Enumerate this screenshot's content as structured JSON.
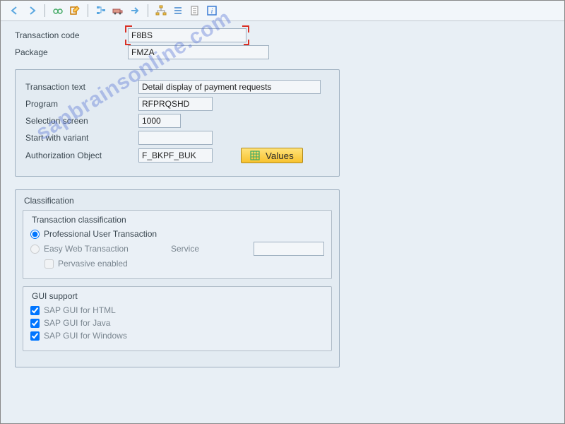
{
  "header": {
    "transaction_code_label": "Transaction code",
    "transaction_code_value": "F8BS",
    "package_label": "Package",
    "package_value": "FMZA"
  },
  "details": {
    "transaction_text_label": "Transaction text",
    "transaction_text_value": "Detail display of payment requests",
    "program_label": "Program",
    "program_value": "RFPRQSHD",
    "selection_screen_label": "Selection screen",
    "selection_screen_value": "1000",
    "start_variant_label": "Start with variant",
    "start_variant_value": "",
    "auth_object_label": "Authorization Object",
    "auth_object_value": "F_BKPF_BUK",
    "values_button": "Values"
  },
  "classification": {
    "group_title": "Classification",
    "tc_group_title": "Transaction classification",
    "radio_professional": "Professional User Transaction",
    "radio_easy_web": "Easy Web Transaction",
    "service_label": "Service",
    "service_value": "",
    "check_pervasive": "Pervasive enabled",
    "gui_group_title": "GUI support",
    "check_gui_html": "SAP GUI for HTML",
    "check_gui_java": "SAP GUI for Java",
    "check_gui_windows": "SAP GUI for Windows"
  },
  "watermark": "sapbrainsonline.com"
}
